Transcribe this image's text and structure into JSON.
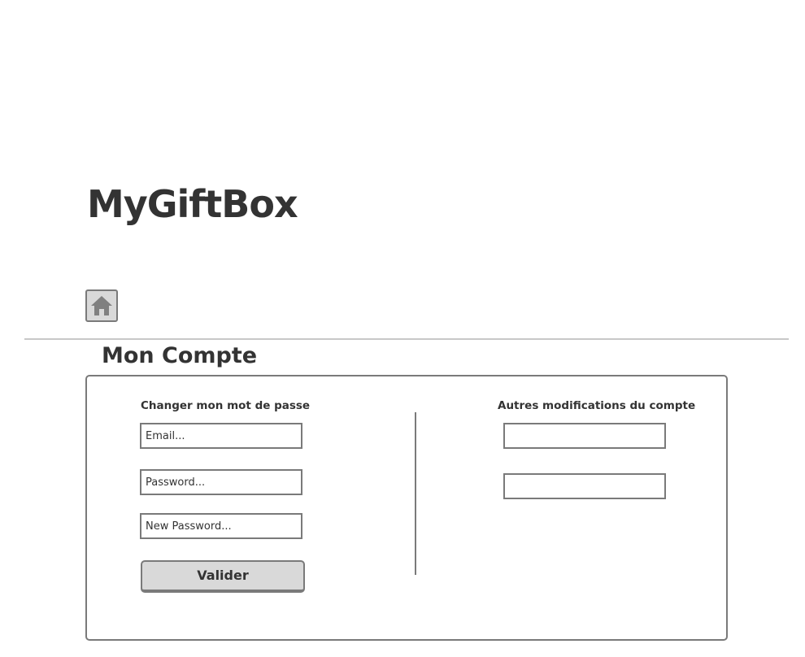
{
  "app": {
    "title": "MyGiftBox"
  },
  "nav": {
    "home_icon": "home-icon"
  },
  "page": {
    "section_title": "Mon Compte"
  },
  "password_form": {
    "heading": "Changer mon mot de passe",
    "email_placeholder": "Email...",
    "email_value": "",
    "password_placeholder": "Password...",
    "password_value": "",
    "new_password_placeholder": "New Password...",
    "new_password_value": "",
    "submit_label": "Valider"
  },
  "other_settings": {
    "heading": "Autres modifications du compte",
    "field_1_value": "",
    "field_2_value": ""
  },
  "colors": {
    "text": "#333333",
    "border": "#7a7a7a",
    "button_bg": "#d9d9d9",
    "divider": "#c8c8c8",
    "background": "#ffffff"
  }
}
